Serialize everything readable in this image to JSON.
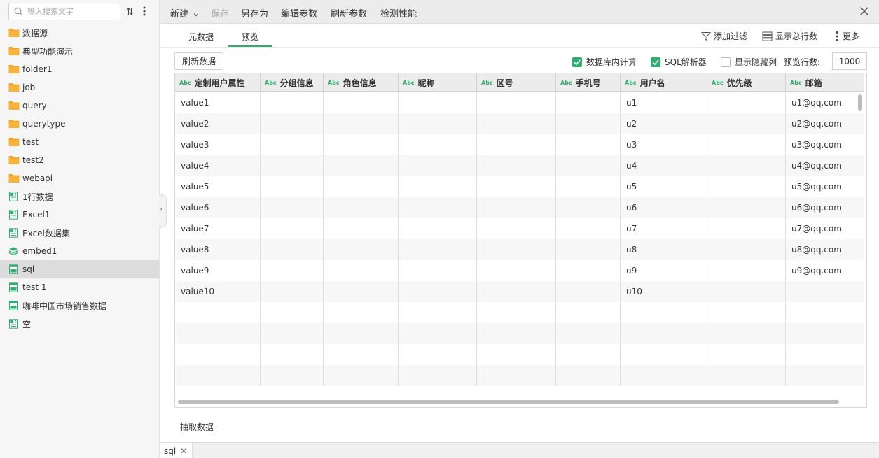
{
  "sidebar": {
    "search_placeholder": "输入搜索文字",
    "items": [
      {
        "label": "数据源",
        "icon": "folder-icon"
      },
      {
        "label": "典型功能演示",
        "icon": "folder-icon"
      },
      {
        "label": "folder1",
        "icon": "folder-icon"
      },
      {
        "label": "job",
        "icon": "folder-icon"
      },
      {
        "label": "query",
        "icon": "folder-icon"
      },
      {
        "label": "querytype",
        "icon": "folder-icon"
      },
      {
        "label": "test",
        "icon": "folder-icon"
      },
      {
        "label": "test2",
        "icon": "folder-icon"
      },
      {
        "label": "webapi",
        "icon": "folder-icon"
      },
      {
        "label": "1行数据",
        "icon": "excel-dataset-icon"
      },
      {
        "label": "Excel1",
        "icon": "excel-dataset-icon"
      },
      {
        "label": "Excel数据集",
        "icon": "excel-dataset-icon"
      },
      {
        "label": "embed1",
        "icon": "embed-dataset-icon"
      },
      {
        "label": "sql",
        "icon": "sql-dataset-icon",
        "selected": true
      },
      {
        "label": "test  1",
        "icon": "sql-dataset-icon"
      },
      {
        "label": "咖啡中国市场销售数据",
        "icon": "sql-dataset-icon"
      },
      {
        "label": "空",
        "icon": "excel-dataset-icon"
      }
    ]
  },
  "toolbar": {
    "new_label": "新建",
    "save_label": "保存",
    "save_as_label": "另存为",
    "edit_params_label": "编辑参数",
    "refresh_params_label": "刷新参数",
    "check_perf_label": "检测性能"
  },
  "tabs": {
    "metadata_label": "元数据",
    "preview_label": "预览",
    "add_filter_label": "添加过滤",
    "show_total_rows_label": "显示总行数",
    "more_label": "更多"
  },
  "options": {
    "refresh_data_label": "刷新数据",
    "db_compute_label": "数据库内计算",
    "db_compute_checked": true,
    "sql_parser_label": "SQL解析器",
    "sql_parser_checked": true,
    "show_hidden_label": "显示隐藏列",
    "show_hidden_checked": false,
    "preview_rows_label": "预览行数:",
    "preview_rows_value": "1000"
  },
  "grid": {
    "type_tag": "Abc",
    "columns": [
      "定制用户属性",
      "分组信息",
      "角色信息",
      "昵称",
      "区号",
      "手机号",
      "用户名",
      "优先级",
      "邮箱"
    ],
    "rows": [
      [
        "value1",
        "",
        "",
        "",
        "",
        "",
        "u1",
        "",
        "u1@qq.com"
      ],
      [
        "value2",
        "",
        "",
        "",
        "",
        "",
        "u2",
        "",
        "u2@qq.com"
      ],
      [
        "value3",
        "",
        "",
        "",
        "",
        "",
        "u3",
        "",
        "u3@qq.com"
      ],
      [
        "value4",
        "",
        "",
        "",
        "",
        "",
        "u4",
        "",
        "u4@qq.com"
      ],
      [
        "value5",
        "",
        "",
        "",
        "",
        "",
        "u5",
        "",
        "u5@qq.com"
      ],
      [
        "value6",
        "",
        "",
        "",
        "",
        "",
        "u6",
        "",
        "u6@qq.com"
      ],
      [
        "value7",
        "",
        "",
        "",
        "",
        "",
        "u7",
        "",
        "u7@qq.com"
      ],
      [
        "value8",
        "",
        "",
        "",
        "",
        "",
        "u8",
        "",
        "u8@qq.com"
      ],
      [
        "value9",
        "",
        "",
        "",
        "",
        "",
        "u9",
        "",
        "u9@qq.com"
      ],
      [
        "value10",
        "",
        "",
        "",
        "",
        "",
        "u10",
        "",
        ""
      ]
    ]
  },
  "footer": {
    "extract_data_label": "抽取数据"
  },
  "bottom_tabs": [
    {
      "label": "sql"
    }
  ],
  "colors": {
    "accent": "#2eaf6f",
    "folder": "#f5a623"
  }
}
